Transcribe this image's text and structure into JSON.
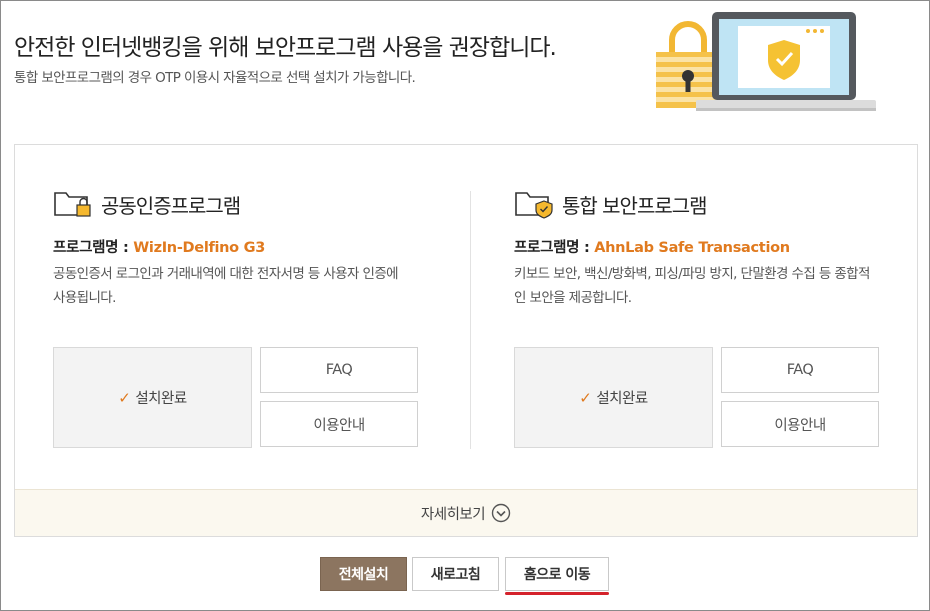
{
  "header": {
    "title": "안전한 인터넷뱅킹을 위해 보안프로그램 사용을 권장합니다.",
    "subtitle": "통합 보안프로그램의 경우 OTP 이용시 자율적으로 선택 설치가 가능합니다."
  },
  "sections": [
    {
      "title": "공동인증프로그램",
      "icon": "folder-lock-icon",
      "program_label": "프로그램명 : ",
      "program_name": "WizIn-Delfino G3",
      "description": "공동인증서 로그인과 거래내역에 대한 전자서명 등 사용자 인증에 사용됩니다.",
      "status": "설치완료",
      "faq_label": "FAQ",
      "guide_label": "이용안내"
    },
    {
      "title": "통합 보안프로그램",
      "icon": "folder-shield-icon",
      "program_label": "프로그램명 : ",
      "program_name": "AhnLab Safe Transaction",
      "description": "키보드 보안, 백신/방화벽, 피싱/파밍 방지, 단말환경 수집 등 종합적인 보안을 제공합니다.",
      "status": "설치완료",
      "faq_label": "FAQ",
      "guide_label": "이용안내"
    }
  ],
  "more": {
    "label": "자세히보기"
  },
  "actions": {
    "install_all": "전체설치",
    "refresh": "새로고침",
    "go_home": "홈으로 이동"
  },
  "colors": {
    "accent_orange": "#e07a1f",
    "install_button": "#8c7560",
    "home_underline": "#d4222b",
    "more_bar_bg": "#fbf8ef"
  }
}
